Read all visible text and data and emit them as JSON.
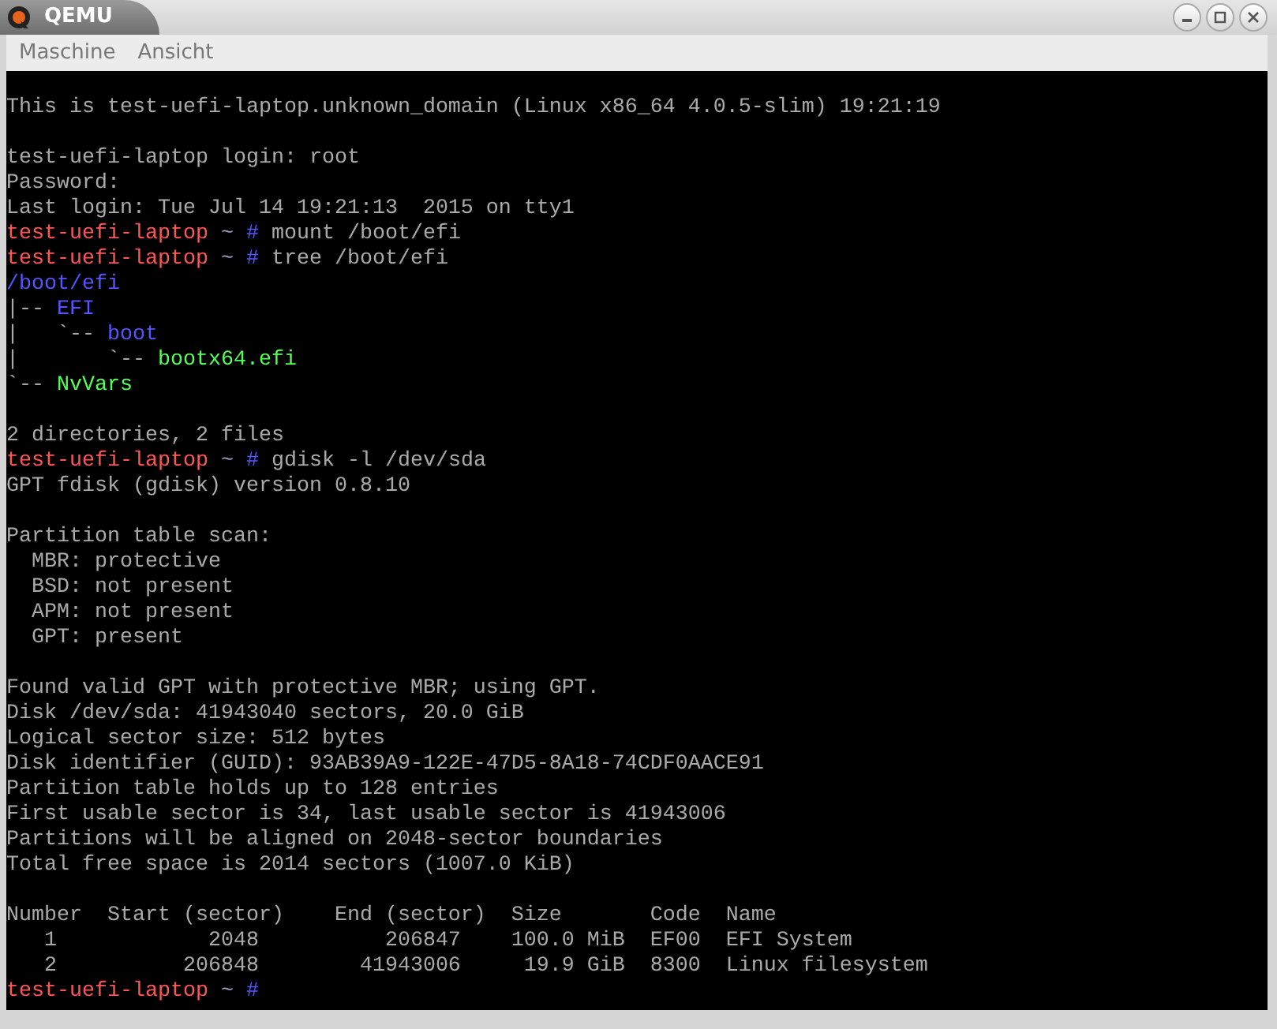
{
  "window": {
    "title": "QEMU"
  },
  "menu": [
    {
      "label": "Maschine"
    },
    {
      "label": "Ansicht"
    }
  ],
  "terminal": {
    "lines": [
      {
        "kind": "blank"
      },
      {
        "kind": "text",
        "segments": [
          {
            "kind": "text",
            "text": "This is test-uefi-laptop.unknown_domain (Linux x86_64 4.0.5-slim) 19:21:19"
          }
        ]
      },
      {
        "kind": "blank"
      },
      {
        "kind": "text",
        "segments": [
          {
            "kind": "text",
            "text": "test-uefi-laptop login: root"
          }
        ]
      },
      {
        "kind": "text",
        "segments": [
          {
            "kind": "text",
            "text": "Password:"
          }
        ]
      },
      {
        "kind": "text",
        "segments": [
          {
            "kind": "text",
            "text": "Last login: Tue Jul 14 19:21:13  2015 on tty1"
          }
        ]
      },
      {
        "kind": "text",
        "segments": [
          {
            "kind": "host",
            "text": "test-uefi-laptop"
          },
          {
            "kind": "cwd",
            "text": " ~ "
          },
          {
            "kind": "hash",
            "text": "#"
          },
          {
            "kind": "text",
            "text": " mount /boot/efi"
          }
        ]
      },
      {
        "kind": "text",
        "segments": [
          {
            "kind": "host",
            "text": "test-uefi-laptop"
          },
          {
            "kind": "cwd",
            "text": " ~ "
          },
          {
            "kind": "hash",
            "text": "#"
          },
          {
            "kind": "text",
            "text": " tree /boot/efi"
          }
        ]
      },
      {
        "kind": "text",
        "segments": [
          {
            "kind": "dir",
            "text": "/boot/efi"
          }
        ]
      },
      {
        "kind": "text",
        "segments": [
          {
            "kind": "text",
            "text": "|-- "
          },
          {
            "kind": "dir",
            "text": "EFI"
          }
        ]
      },
      {
        "kind": "text",
        "segments": [
          {
            "kind": "text",
            "text": "|   `-- "
          },
          {
            "kind": "dir",
            "text": "boot"
          }
        ]
      },
      {
        "kind": "text",
        "segments": [
          {
            "kind": "text",
            "text": "|       `-- "
          },
          {
            "kind": "file",
            "text": "bootx64.efi"
          }
        ]
      },
      {
        "kind": "text",
        "segments": [
          {
            "kind": "text",
            "text": "`-- "
          },
          {
            "kind": "file",
            "text": "NvVars"
          }
        ]
      },
      {
        "kind": "blank"
      },
      {
        "kind": "text",
        "segments": [
          {
            "kind": "text",
            "text": "2 directories, 2 files"
          }
        ]
      },
      {
        "kind": "text",
        "segments": [
          {
            "kind": "host",
            "text": "test-uefi-laptop"
          },
          {
            "kind": "cwd",
            "text": " ~ "
          },
          {
            "kind": "hash",
            "text": "#"
          },
          {
            "kind": "text",
            "text": " gdisk -l /dev/sda"
          }
        ]
      },
      {
        "kind": "text",
        "segments": [
          {
            "kind": "text",
            "text": "GPT fdisk (gdisk) version 0.8.10"
          }
        ]
      },
      {
        "kind": "blank"
      },
      {
        "kind": "text",
        "segments": [
          {
            "kind": "text",
            "text": "Partition table scan:"
          }
        ]
      },
      {
        "kind": "text",
        "segments": [
          {
            "kind": "text",
            "text": "  MBR: protective"
          }
        ]
      },
      {
        "kind": "text",
        "segments": [
          {
            "kind": "text",
            "text": "  BSD: not present"
          }
        ]
      },
      {
        "kind": "text",
        "segments": [
          {
            "kind": "text",
            "text": "  APM: not present"
          }
        ]
      },
      {
        "kind": "text",
        "segments": [
          {
            "kind": "text",
            "text": "  GPT: present"
          }
        ]
      },
      {
        "kind": "blank"
      },
      {
        "kind": "text",
        "segments": [
          {
            "kind": "text",
            "text": "Found valid GPT with protective MBR; using GPT."
          }
        ]
      },
      {
        "kind": "text",
        "segments": [
          {
            "kind": "text",
            "text": "Disk /dev/sda: 41943040 sectors, 20.0 GiB"
          }
        ]
      },
      {
        "kind": "text",
        "segments": [
          {
            "kind": "text",
            "text": "Logical sector size: 512 bytes"
          }
        ]
      },
      {
        "kind": "text",
        "segments": [
          {
            "kind": "text",
            "text": "Disk identifier (GUID): 93AB39A9-122E-47D5-8A18-74CDF0AACE91"
          }
        ]
      },
      {
        "kind": "text",
        "segments": [
          {
            "kind": "text",
            "text": "Partition table holds up to 128 entries"
          }
        ]
      },
      {
        "kind": "text",
        "segments": [
          {
            "kind": "text",
            "text": "First usable sector is 34, last usable sector is 41943006"
          }
        ]
      },
      {
        "kind": "text",
        "segments": [
          {
            "kind": "text",
            "text": "Partitions will be aligned on 2048-sector boundaries"
          }
        ]
      },
      {
        "kind": "text",
        "segments": [
          {
            "kind": "text",
            "text": "Total free space is 2014 sectors (1007.0 KiB)"
          }
        ]
      },
      {
        "kind": "blank"
      },
      {
        "kind": "text",
        "segments": [
          {
            "kind": "text",
            "text": "Number  Start (sector)    End (sector)  Size       Code  Name"
          }
        ]
      },
      {
        "kind": "text",
        "segments": [
          {
            "kind": "text",
            "text": "   1            2048          206847    100.0 MiB  EF00  EFI System"
          }
        ]
      },
      {
        "kind": "text",
        "segments": [
          {
            "kind": "text",
            "text": "   2          206848        41943006     19.9 GiB  8300  Linux filesystem"
          }
        ]
      },
      {
        "kind": "text",
        "segments": [
          {
            "kind": "host",
            "text": "test-uefi-laptop"
          },
          {
            "kind": "cwd",
            "text": " ~ "
          },
          {
            "kind": "hash",
            "text": "#"
          }
        ]
      }
    ]
  }
}
